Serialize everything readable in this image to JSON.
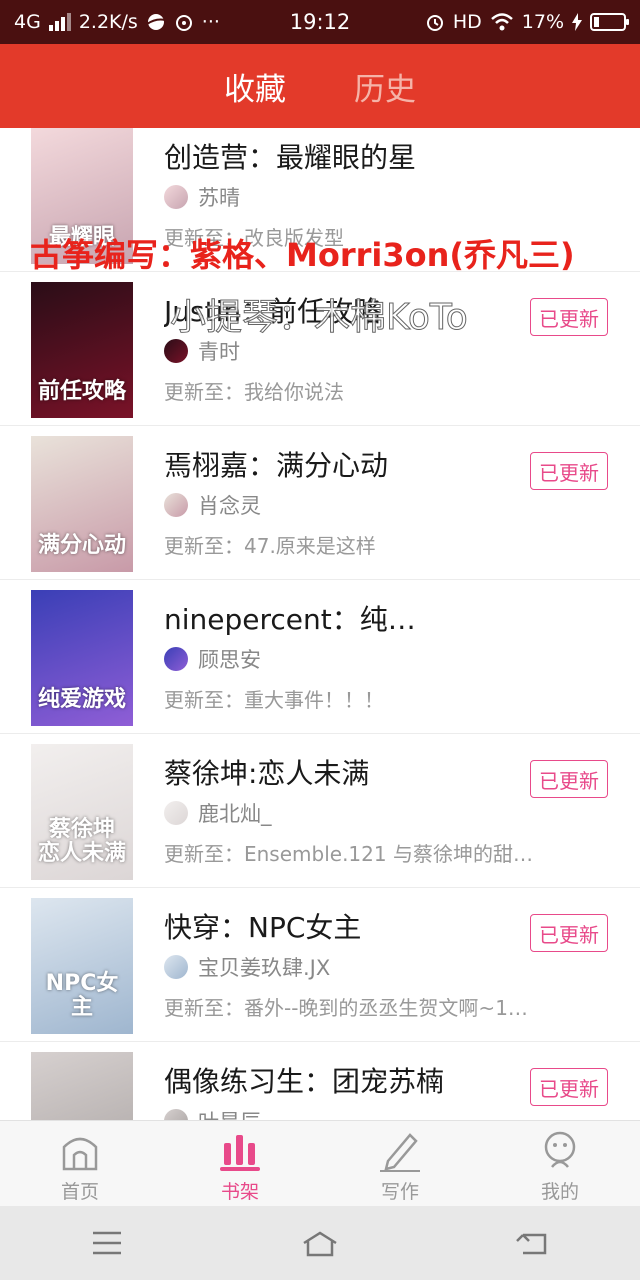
{
  "status_bar": {
    "network": "4G",
    "speed": "2.2K/s",
    "more": "···",
    "time": "19:12",
    "hd": "HD",
    "battery_text": "17%",
    "battery_level": 0.17
  },
  "header": {
    "tabs": [
      {
        "label": "收藏",
        "active": true
      },
      {
        "label": "历史",
        "active": false
      }
    ]
  },
  "overlay": {
    "line1": "古筝编写：紫格、Morri3on(乔凡三)",
    "line2": "小提琴：木棉KoTo"
  },
  "books": [
    {
      "title": "创造营：最耀眼的星",
      "author": "苏晴",
      "update": "更新至：改良版发型",
      "badge": "",
      "cover_caption": "最耀眼",
      "cover_colors": [
        "#f3d9dc",
        "#c7a4b0"
      ]
    },
    {
      "title": "Justin：前任攻略",
      "author": "青时",
      "update": "更新至：我给你说法",
      "badge": "已更新",
      "cover_caption": "前任攻略",
      "cover_colors": [
        "#2a0d17",
        "#7a1228"
      ]
    },
    {
      "title": "焉栩嘉：满分心动",
      "author": "肖念灵",
      "update": "更新至：47.原来是这样",
      "badge": "已更新",
      "cover_caption": "满分心动",
      "cover_colors": [
        "#e9e2da",
        "#c89aa8"
      ]
    },
    {
      "title": "ninepercent：纯…",
      "author": "顾思安",
      "update": "更新至：重大事件！！！",
      "badge": "",
      "cover_caption": "纯爱游戏",
      "cover_colors": [
        "#3a3fb6",
        "#8f5ed6"
      ]
    },
    {
      "title": "蔡徐坤:恋人未满",
      "author": "鹿北灿_",
      "update": "更新至：Ensemble.121 与蔡徐坤的甜…",
      "badge": "已更新",
      "cover_caption": "蔡徐坤 恋人未满",
      "cover_colors": [
        "#f2efee",
        "#dcd6d6"
      ]
    },
    {
      "title": "快穿：NPC女主",
      "author": "宝贝姜玖肆.JX",
      "update": "更新至：番外--晚到的丞丞生贺文啊~1…",
      "badge": "已更新",
      "cover_caption": "NPC女主",
      "cover_colors": [
        "#dde6ef",
        "#9fb6cf"
      ]
    },
    {
      "title": "偶像练习生：团宠苏楠",
      "author": "叶星辰",
      "update": "",
      "badge": "已更新",
      "cover_caption": "",
      "cover_colors": [
        "#d6d0cf",
        "#a9a3a2"
      ]
    }
  ],
  "tabbar": {
    "items": [
      {
        "label": "首页",
        "icon": "home-icon",
        "active": false
      },
      {
        "label": "书架",
        "icon": "bookshelf-icon",
        "active": true
      },
      {
        "label": "写作",
        "icon": "pen-icon",
        "active": false
      },
      {
        "label": "我的",
        "icon": "user-icon",
        "active": false
      }
    ]
  },
  "colors": {
    "header_red": "#e33a2a",
    "accent_pink": "#e84a8a",
    "status_bar": "#4a1010",
    "overlay_red": "#e8231c"
  }
}
